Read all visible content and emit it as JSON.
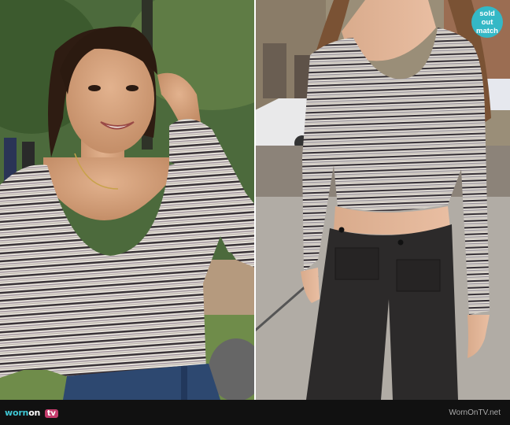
{
  "footer": {
    "brand_worn": "worn",
    "brand_on": "on",
    "brand_tv": "tv",
    "site": "WornOnTV.net"
  },
  "badge": {
    "line1": "sold",
    "line2": "out",
    "line3": "match"
  },
  "colors": {
    "stripe_dark": "#3a3338",
    "stripe_light": "#e8e4dc",
    "stripe_mid": "#8e8790",
    "jeans": "#2d4870",
    "pants": "#2c2a2a",
    "badge": "#34b8c6"
  }
}
